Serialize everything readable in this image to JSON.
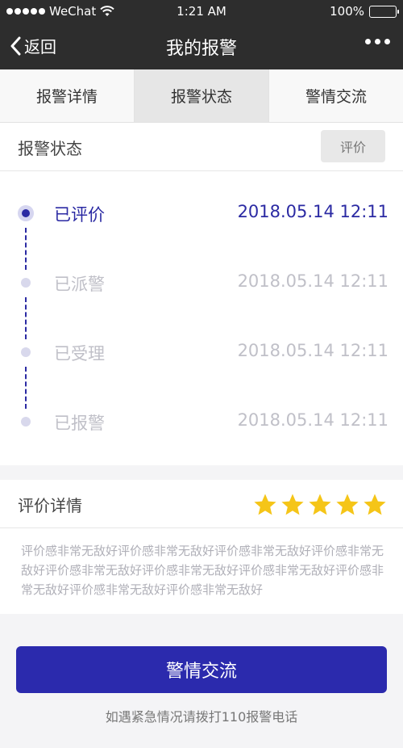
{
  "status_bar": {
    "carrier": "WeChat",
    "time": "1:21 AM",
    "battery": "100%"
  },
  "nav": {
    "back_label": "返回",
    "title": "我的报警"
  },
  "tabs": [
    {
      "label": "报警详情",
      "active": false
    },
    {
      "label": "报警状态",
      "active": true
    },
    {
      "label": "警情交流",
      "active": false
    }
  ],
  "status_section": {
    "title": "报警状态",
    "rate_button_label": "评价",
    "timeline": [
      {
        "label": "已评价",
        "time": "2018.05.14 12:11",
        "active": true
      },
      {
        "label": "已派警",
        "time": "2018.05.14 12:11",
        "active": false
      },
      {
        "label": "已受理",
        "time": "2018.05.14 12:11",
        "active": false
      },
      {
        "label": "已报警",
        "time": "2018.05.14 12:11",
        "active": false
      }
    ]
  },
  "evaluation": {
    "title": "评价详情",
    "rating": 5,
    "rating_max": 5,
    "text": "评价感非常无敌好评价感非常无敌好评价感非常无敌好评价感非常无敌好评价感非常无敌好评价感非常无敌好评价感非常无敌好评价感非常无敌好评价感非常无敌好评价感非常无敌好"
  },
  "primary_button_label": "警情交流",
  "hint": "如遇紧急情况请拨打110报警电话",
  "colors": {
    "accent": "#2b2aad",
    "star": "#f5c518",
    "nav_bg": "#2d2d2d"
  }
}
